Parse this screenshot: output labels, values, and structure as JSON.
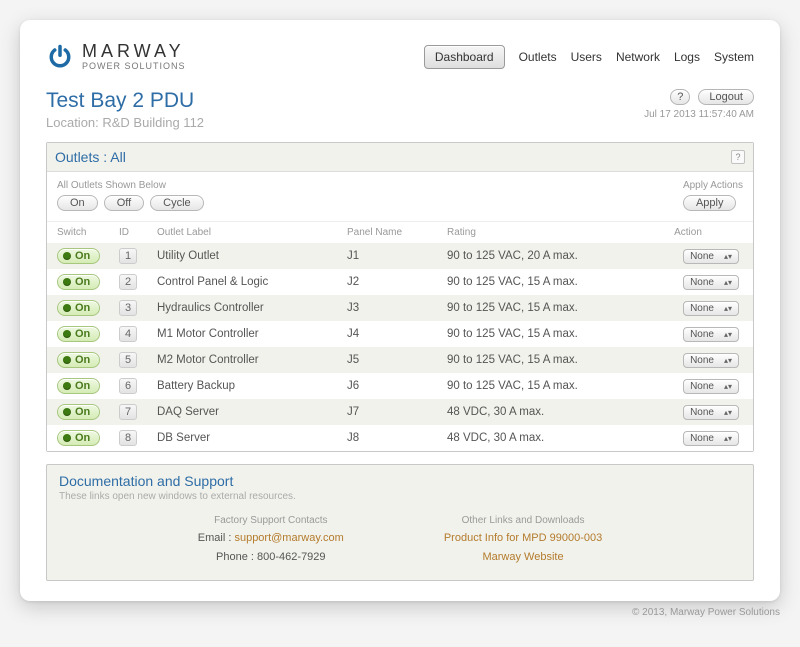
{
  "brand": {
    "name": "MARWAY",
    "tagline": "POWER SOLUTIONS"
  },
  "nav": {
    "active": "Dashboard",
    "items": [
      "Outlets",
      "Users",
      "Network",
      "Logs",
      "System"
    ]
  },
  "page": {
    "title": "Test Bay 2 PDU",
    "location": "Location: R&D Building 112",
    "help_label": "?",
    "logout_label": "Logout",
    "timestamp": "Jul 17 2013 11:57:40 AM"
  },
  "outlets_panel": {
    "title": "Outlets : All",
    "left_caption": "All Outlets Shown Below",
    "right_caption": "Apply Actions",
    "buttons": {
      "on": "On",
      "off": "Off",
      "cycle": "Cycle",
      "apply": "Apply"
    },
    "columns": {
      "switch": "Switch",
      "id": "ID",
      "label": "Outlet Label",
      "panel": "Panel Name",
      "rating": "Rating",
      "action": "Action"
    },
    "switch_label": "On",
    "action_default": "None",
    "rows": [
      {
        "id": "1",
        "label": "Utility Outlet",
        "panel": "J1",
        "rating": "90 to 125 VAC, 20 A max."
      },
      {
        "id": "2",
        "label": "Control Panel & Logic",
        "panel": "J2",
        "rating": "90 to 125 VAC, 15 A max."
      },
      {
        "id": "3",
        "label": "Hydraulics Controller",
        "panel": "J3",
        "rating": "90 to 125 VAC, 15 A max."
      },
      {
        "id": "4",
        "label": "M1 Motor Controller",
        "panel": "J4",
        "rating": "90 to 125 VAC, 15 A max."
      },
      {
        "id": "5",
        "label": "M2 Motor Controller",
        "panel": "J5",
        "rating": "90 to 125 VAC, 15 A max."
      },
      {
        "id": "6",
        "label": "Battery Backup",
        "panel": "J6",
        "rating": "90 to 125 VAC, 15 A max."
      },
      {
        "id": "7",
        "label": "DAQ Server",
        "panel": "J7",
        "rating": "48 VDC, 30 A max."
      },
      {
        "id": "8",
        "label": "DB Server",
        "panel": "J8",
        "rating": "48 VDC, 30 A max."
      }
    ]
  },
  "support": {
    "title": "Documentation and Support",
    "subtitle": "These links open new windows to external resources.",
    "left": {
      "header": "Factory Support Contacts",
      "email_lbl": "Email : ",
      "email": "support@marway.com",
      "phone_lbl": "Phone : ",
      "phone": "800-462-7929"
    },
    "right": {
      "header": "Other Links and Downloads",
      "link1": "Product Info for MPD 99000-003",
      "link2": "Marway Website"
    }
  },
  "footer": "© 2013, Marway Power Solutions"
}
